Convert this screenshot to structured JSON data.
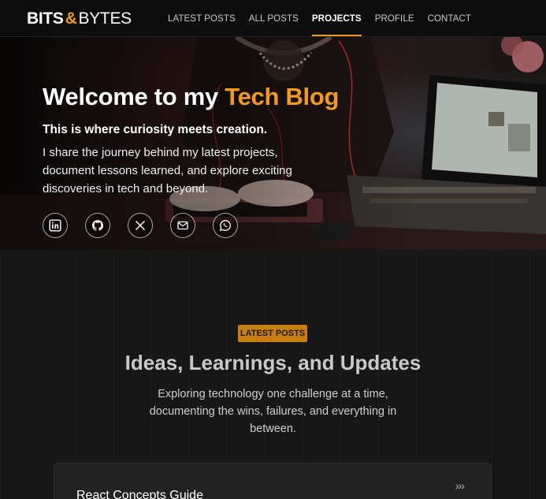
{
  "brand": {
    "part1": "BITS",
    "amp": "&",
    "part2": "BYTES"
  },
  "nav": {
    "items": [
      {
        "label": "LATEST POSTS",
        "active": false
      },
      {
        "label": "ALL POSTS",
        "active": false
      },
      {
        "label": "PROJECTS",
        "active": true
      },
      {
        "label": "PROFILE",
        "active": false
      },
      {
        "label": "CONTACT",
        "active": false
      }
    ]
  },
  "hero": {
    "title_plain": "Welcome to my",
    "title_accent": "Tech Blog",
    "subtitle": "This is where curiosity meets creation.",
    "description": "I share the journey behind my latest projects, document lessons learned, and explore exciting discoveries in tech and beyond.",
    "socials": [
      "linkedin-icon",
      "github-icon",
      "x-icon",
      "mail-icon",
      "whatsapp-icon"
    ]
  },
  "section": {
    "badge": "LATEST POSTS",
    "title": "Ideas, Learnings, and Updates",
    "description": "Exploring technology one challenge at a time, documenting the wins, failures, and everything in between."
  },
  "post_card": {
    "title": "React Concepts Guide",
    "arrow": "›››"
  },
  "colors": {
    "accent": "#f29a1e",
    "badge_bg": "#c97e12",
    "nav_bg": "#0d0d0d",
    "page_bg": "#171717"
  }
}
